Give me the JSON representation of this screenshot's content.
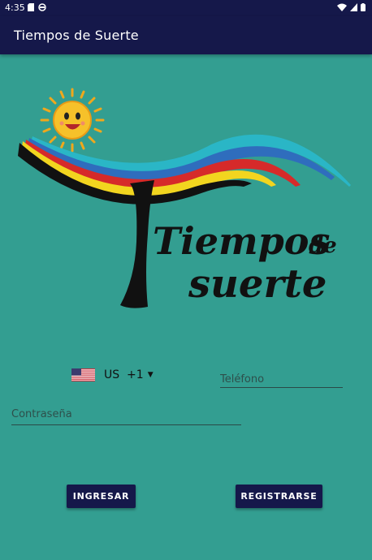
{
  "status_bar": {
    "time": "4:35",
    "icons": [
      "sd-card-icon",
      "sync-icon",
      "wifi-icon",
      "signal-icon",
      "battery-icon"
    ]
  },
  "app_bar": {
    "title": "Tiempos de Suerte"
  },
  "logo": {
    "line1": "Tiempos",
    "line1b": "de",
    "line2": "suerte"
  },
  "country_picker": {
    "code": "US",
    "dial": "+1"
  },
  "phone": {
    "placeholder": "Teléfono",
    "value": ""
  },
  "password": {
    "placeholder": "Contraseña",
    "value": ""
  },
  "buttons": {
    "login": "INGRESAR",
    "register": "REGISTRARSE"
  },
  "colors": {
    "background": "#339e91",
    "primary": "#15184a"
  }
}
